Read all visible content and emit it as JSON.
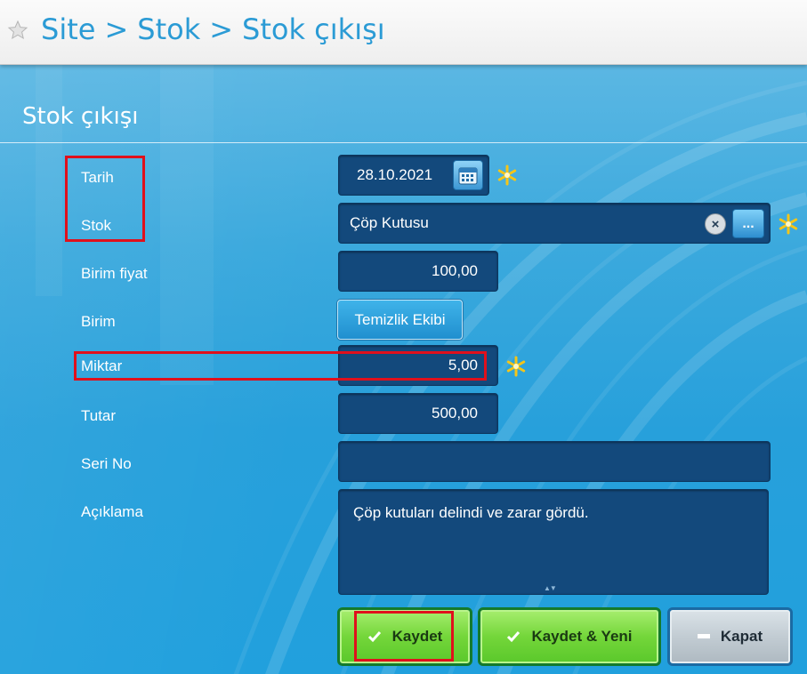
{
  "breadcrumb": {
    "items": [
      "Site",
      "Stok",
      "Stok çıkışı"
    ],
    "separator": ">"
  },
  "form": {
    "title": "Stok çıkışı",
    "fields": {
      "tarih": {
        "label": "Tarih",
        "value": "28.10.2021",
        "required": true
      },
      "stok": {
        "label": "Stok",
        "value": "Çöp Kutusu",
        "required": true
      },
      "birim_fiyat": {
        "label": "Birim fiyat",
        "value": "100,00"
      },
      "birim": {
        "label": "Birim",
        "value": "Temizlik Ekibi"
      },
      "miktar": {
        "label": "Miktar",
        "value": "5,00",
        "required": true
      },
      "tutar": {
        "label": "Tutar",
        "value": "500,00"
      },
      "seri_no": {
        "label": "Seri No",
        "value": ""
      },
      "aciklama": {
        "label": "Açıklama",
        "value": "Çöp kutuları delindi ve zarar gördü."
      }
    }
  },
  "buttons": {
    "save": "Kaydet",
    "save_new": "Kaydet & Yeni",
    "close": "Kapat"
  },
  "colors": {
    "accent": "#2b9bd5",
    "field_bg": "#13497c",
    "required_star": "#f5c518",
    "highlight": "#e0101c",
    "button_green": "#74d63a",
    "button_gray": "#c2ccd3"
  }
}
